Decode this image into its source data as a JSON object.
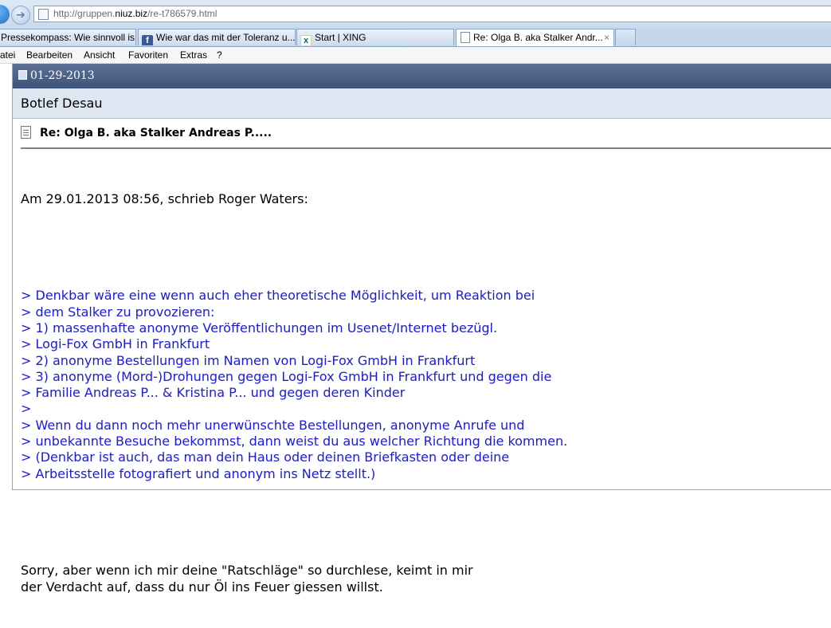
{
  "browser": {
    "url_prefix": "http://gruppen.",
    "url_domain": "niuz.biz",
    "url_suffix": "/re-t786579.html",
    "tabs": [
      {
        "label": "Pressekompass: Wie sinnvoll is...",
        "icon": "none"
      },
      {
        "label": "Wie war das mit der Toleranz u...",
        "icon": "facebook-icon"
      },
      {
        "label": "Start | XING",
        "icon": "xing-icon"
      },
      {
        "label": "Re: Olga B. aka Stalker Andr...",
        "icon": "page-icon",
        "active": true
      }
    ],
    "tab_close": "×",
    "menu": [
      "atei",
      "Bearbeiten",
      "Ansicht",
      "Favoriten",
      "Extras",
      "?"
    ]
  },
  "post": {
    "date": "01-29-2013",
    "author": "Botlef Desau",
    "title": "Re: Olga B. aka Stalker Andreas P.....",
    "intro": "Am 29.01.2013 08:56, schrieb Roger Waters:",
    "quote_lines": [
      "> Denkbar wäre eine wenn auch eher theoretische Möglichkeit, um Reaktion bei",
      "> dem Stalker zu provozieren:",
      "> 1) massenhafte anonyme Veröffentlichungen im Usenet/Internet bezügl.",
      "> Logi-Fox GmbH in Frankfurt",
      "> 2) anonyme Bestellungen im Namen von Logi-Fox GmbH in Frankfurt",
      "> 3) anonyme (Mord-)Drohungen gegen Logi-Fox GmbH in Frankfurt und gegen die",
      "> Familie Andreas P... & Kristina P... und gegen deren Kinder",
      ">",
      "> Wenn du dann noch mehr unerwünschte Bestellungen, anonyme Anrufe und",
      "> unbekannte Besuche bekommst, dann weist du aus welcher Richtung die kommen.",
      "> (Denkbar ist auch, das man dein Haus oder deinen Briefkasten oder deine",
      "> Arbeitsstelle fotografiert und anonym ins Netz stellt.)"
    ],
    "reply_lines": [
      "Sorry, aber wenn ich mir deine \"Ratschläge\" so durchlese, keimt in mir",
      "der Verdacht auf, dass du nur Öl ins Feuer giessen willst."
    ]
  },
  "colors": {
    "quote": "#1a1adb",
    "datebar": "#4a5f84",
    "authorbar": "#dde6f1"
  }
}
